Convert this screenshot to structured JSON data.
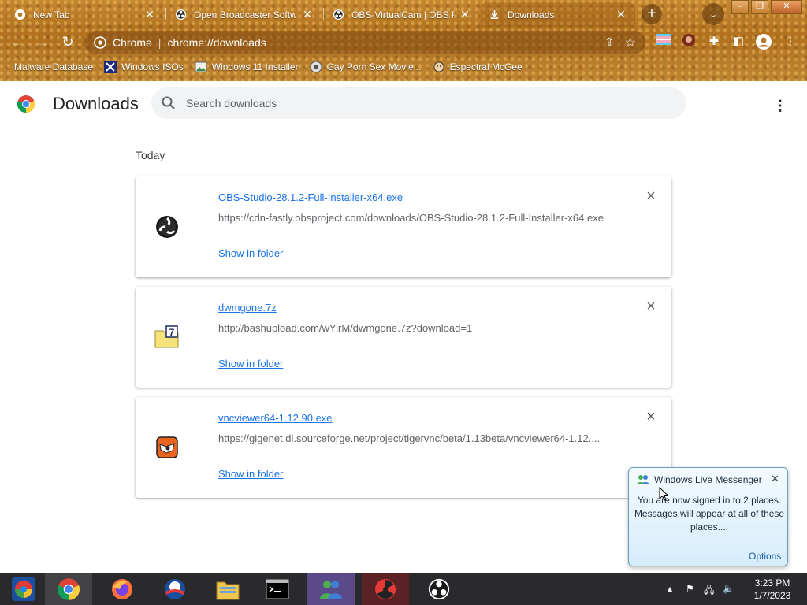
{
  "window": {
    "tabs": [
      {
        "title": "New Tab",
        "favicon": "chrome-icon"
      },
      {
        "title": "Open Broadcaster Softwa",
        "favicon": "obs-icon"
      },
      {
        "title": "OBS-VirtualCam | OBS Fo",
        "favicon": "obs-icon"
      },
      {
        "title": "Downloads",
        "favicon": "download-icon",
        "active": true
      }
    ],
    "controls": {
      "minimize": "–",
      "maximize": "❐",
      "close": "✕"
    }
  },
  "toolbar": {
    "site_name": "Chrome",
    "url": "chrome://downloads"
  },
  "bookmarks": [
    {
      "label": "Malware Database",
      "icon": "folder-icon"
    },
    {
      "label": "Windows ISOs",
      "icon": "x-icon"
    },
    {
      "label": "Windows 11 Installer",
      "icon": "image-icon"
    },
    {
      "label": "Gay Porn Sex Movie...",
      "icon": "site-icon"
    },
    {
      "label": "Espectral McGee",
      "icon": "face-icon"
    }
  ],
  "page": {
    "title": "Downloads",
    "search_placeholder": "Search downloads",
    "section": "Today"
  },
  "downloads": [
    {
      "name": "OBS-Studio-28.1.2-Full-Installer-x64.exe",
      "url": "https://cdn-fastly.obsproject.com/downloads/OBS-Studio-28.1.2-Full-Installer-x64.exe",
      "action": "Show in folder",
      "icon": "obs-icon"
    },
    {
      "name": "dwmgone.7z",
      "url": "http://bashupload.com/wYirM/dwmgone.7z?download=1",
      "action": "Show in folder",
      "icon": "7zip-icon"
    },
    {
      "name": "vncviewer64-1.12.90.exe",
      "url": "https://gigenet.dl.sourceforge.net/project/tigervnc/beta/1.13beta/vncviewer64-1.12....",
      "action": "Show in folder",
      "icon": "tigervnc-icon"
    }
  ],
  "notification": {
    "title": "Windows Live Messenger",
    "message": "You are now signed in to 2 places. Messages will appear at all of these places....",
    "options": "Options"
  },
  "taskbar": {
    "time": "3:23 PM",
    "date": "1/7/2023",
    "apps": [
      "start-icon",
      "chrome-icon",
      "firefox-icon",
      "obama-icon",
      "explorer-icon",
      "cmd-icon",
      "messenger-icon",
      "radiation-icon",
      "obs-icon"
    ]
  },
  "colors": {
    "link": "#1a73e8",
    "chrome_bg": "#b7782a"
  }
}
